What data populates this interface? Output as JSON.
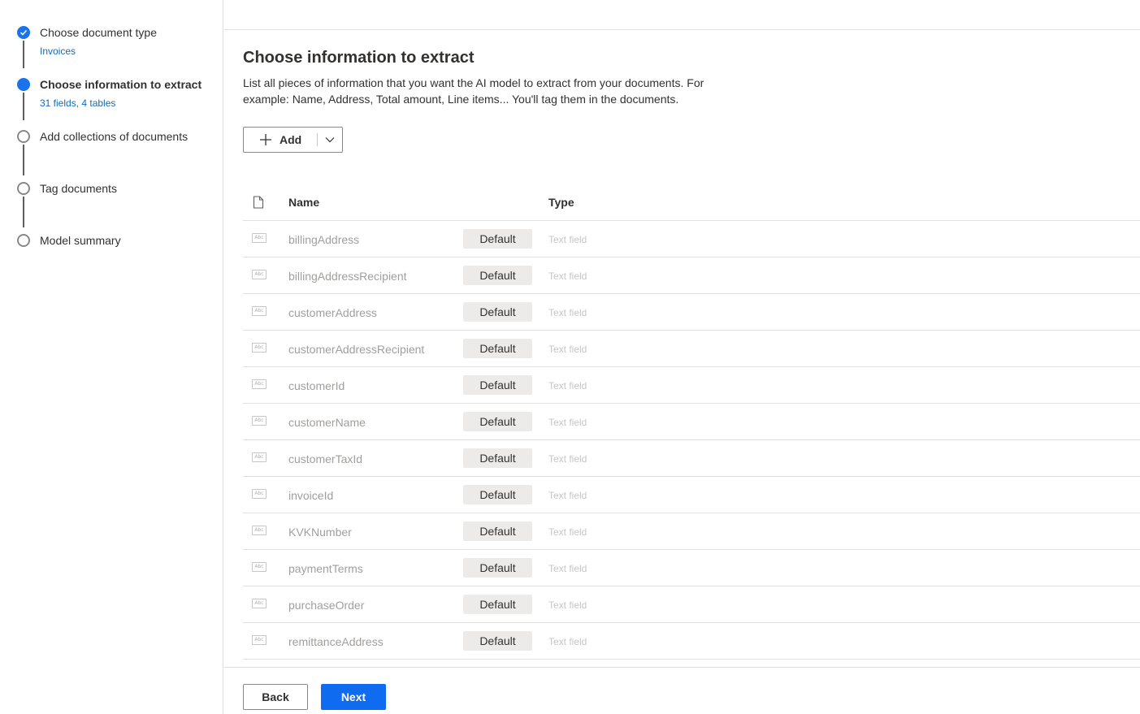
{
  "steps": [
    {
      "title": "Choose document type",
      "subtitle": "Invoices",
      "state": "done"
    },
    {
      "title": "Choose information to extract",
      "subtitle": "31 fields, 4 tables",
      "state": "current"
    },
    {
      "title": "Add collections of documents",
      "subtitle": "",
      "state": "pending"
    },
    {
      "title": "Tag documents",
      "subtitle": "",
      "state": "pending"
    },
    {
      "title": "Model summary",
      "subtitle": "",
      "state": "pending"
    }
  ],
  "main": {
    "title": "Choose information to extract",
    "description": "List all pieces of information that you want the AI model to extract from your documents. For example: Name, Address, Total amount, Line items... You'll tag them in the documents.",
    "add_button": {
      "label": "Add",
      "icon": "plus-icon",
      "dropdown_icon": "chevron-down-icon"
    }
  },
  "table": {
    "header_icon": "document-icon",
    "columns": {
      "name": "Name",
      "type": "Type"
    },
    "row_icon_text": "Abc",
    "rows": [
      {
        "name": "billingAddress",
        "badge": "Default",
        "type": "Text field"
      },
      {
        "name": "billingAddressRecipient",
        "badge": "Default",
        "type": "Text field"
      },
      {
        "name": "customerAddress",
        "badge": "Default",
        "type": "Text field"
      },
      {
        "name": "customerAddressRecipient",
        "badge": "Default",
        "type": "Text field"
      },
      {
        "name": "customerId",
        "badge": "Default",
        "type": "Text field"
      },
      {
        "name": "customerName",
        "badge": "Default",
        "type": "Text field"
      },
      {
        "name": "customerTaxId",
        "badge": "Default",
        "type": "Text field"
      },
      {
        "name": "invoiceId",
        "badge": "Default",
        "type": "Text field"
      },
      {
        "name": "KVKNumber",
        "badge": "Default",
        "type": "Text field"
      },
      {
        "name": "paymentTerms",
        "badge": "Default",
        "type": "Text field"
      },
      {
        "name": "purchaseOrder",
        "badge": "Default",
        "type": "Text field"
      },
      {
        "name": "remittanceAddress",
        "badge": "Default",
        "type": "Text field"
      }
    ]
  },
  "footer": {
    "back_label": "Back",
    "next_label": "Next"
  },
  "colors": {
    "accent": "#1a73e8",
    "primary_button": "#0f6cf0",
    "link": "#0f6cbd"
  }
}
